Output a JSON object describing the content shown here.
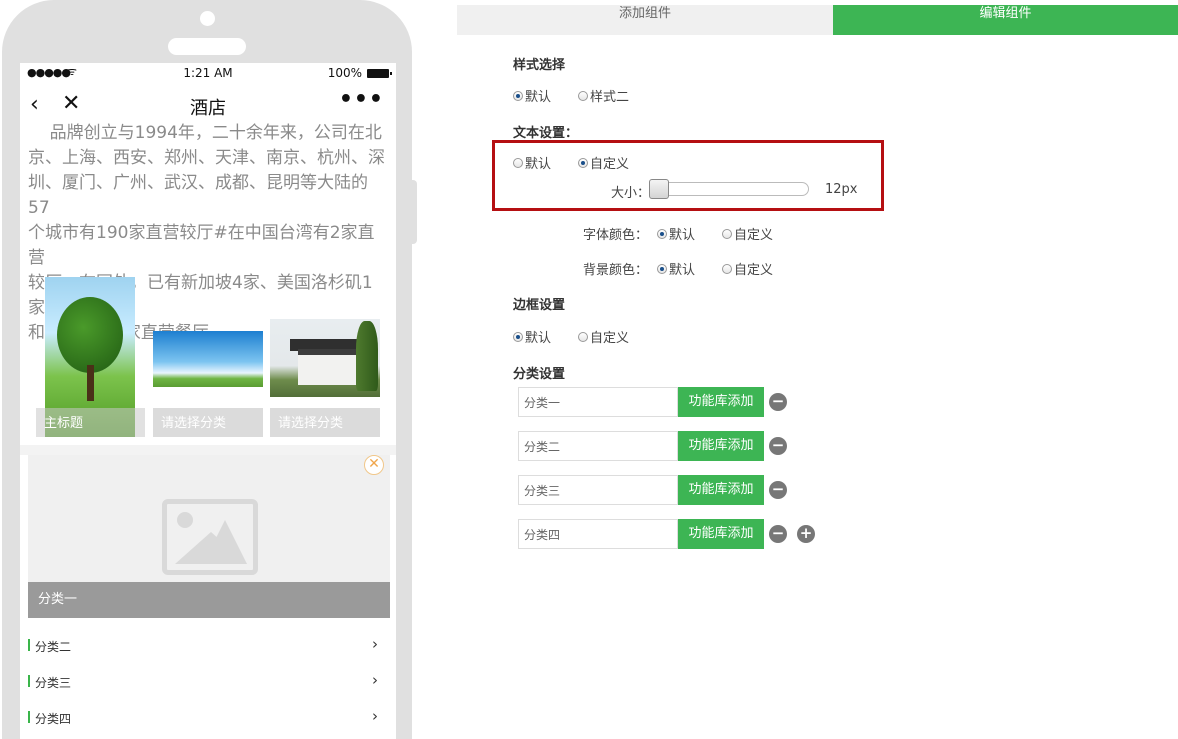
{
  "phone": {
    "status": {
      "signal": "●●●●●",
      "time": "1:21 AM",
      "battery": "100%"
    },
    "nav": {
      "title": "酒店",
      "back_icon": "‹",
      "close_icon": "✕",
      "more_icon": "•••"
    },
    "article": "    品牌创立与1994年，二十余年来，公司在北\n京、上海、西安、郑州、天津、南京、杭州、深\n圳、厦门、广州、武汉、成都、昆明等大陆的57\n个城市有190家直营较厅#在中国台湾有2家直营\n较厅。在国外，已有新加坡4家、美国洛杉矶1家\n和日本东京1家直营餐厅",
    "gallery": [
      {
        "label": "主标题"
      },
      {
        "label": "请选择分类"
      },
      {
        "label": "请选择分类"
      }
    ],
    "card": {
      "label": "分类一"
    },
    "list": [
      {
        "label": "分类二"
      },
      {
        "label": "分类三"
      },
      {
        "label": "分类四"
      }
    ]
  },
  "editor": {
    "tabs": {
      "add": "添加组件",
      "edit": "编辑组件"
    },
    "style_section": {
      "title": "样式选择",
      "opt1": "默认",
      "opt2": "样式二"
    },
    "text_section": {
      "title": "文本设置：",
      "opt1": "默认",
      "opt2": "自定义",
      "size_label": "大小：",
      "size_value": "12px",
      "size_level": 0.0,
      "font_color_label": "字体颜色：",
      "bg_color_label": "背景颜色：",
      "color_opt1": "默认",
      "color_opt2": "自定义"
    },
    "border_section": {
      "title": "边框设置",
      "opt1": "默认",
      "opt2": "自定义"
    },
    "category_section": {
      "title": "分类设置",
      "button_label": "功能库添加",
      "rows": [
        {
          "value": "分类一"
        },
        {
          "value": "分类二"
        },
        {
          "value": "分类三"
        },
        {
          "value": "分类四"
        }
      ],
      "minus_icon": "−",
      "plus_icon": "+"
    },
    "colors": {
      "accent": "#3db554",
      "highlight": "#b50f12"
    }
  }
}
